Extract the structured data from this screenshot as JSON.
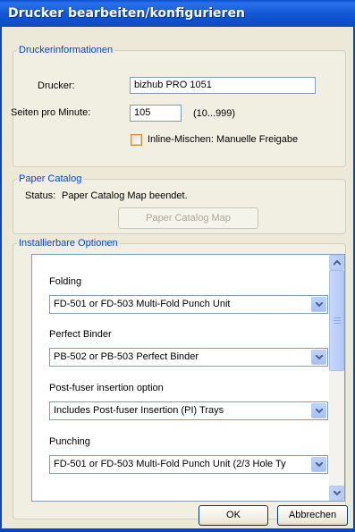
{
  "window": {
    "title": "Drucker bearbeiten/konfigurieren"
  },
  "info": {
    "legend": "Druckerinformationen",
    "printer_label": "Drucker:",
    "printer_value": "bizhub PRO 1051",
    "ppm_label": "Seiten pro Minute:",
    "ppm_value": "105",
    "ppm_range": "(10...999)",
    "inline_label": "Inline-Mischen: Manuelle Freigabe",
    "inline_checked": false
  },
  "catalog": {
    "legend": "Paper Catalog",
    "status_label": "Status:",
    "status_value": "Paper Catalog Map beendet.",
    "button": "Paper Catalog Map"
  },
  "options": {
    "legend": "Installierbare Optionen",
    "items": [
      {
        "label": "Folding",
        "value": "FD-501 or FD-503 Multi-Fold Punch Unit"
      },
      {
        "label": "Perfect Binder",
        "value": "PB-502 or PB-503 Perfect Binder"
      },
      {
        "label": "Post-fuser insertion option",
        "value": "Includes Post-fuser Insertion (PI) Trays"
      },
      {
        "label": "Punching",
        "value": "FD-501 or FD-503 Multi-Fold Punch Unit (2/3 Hole Ty"
      }
    ]
  },
  "buttons": {
    "ok": "OK",
    "cancel": "Abbrechen"
  }
}
